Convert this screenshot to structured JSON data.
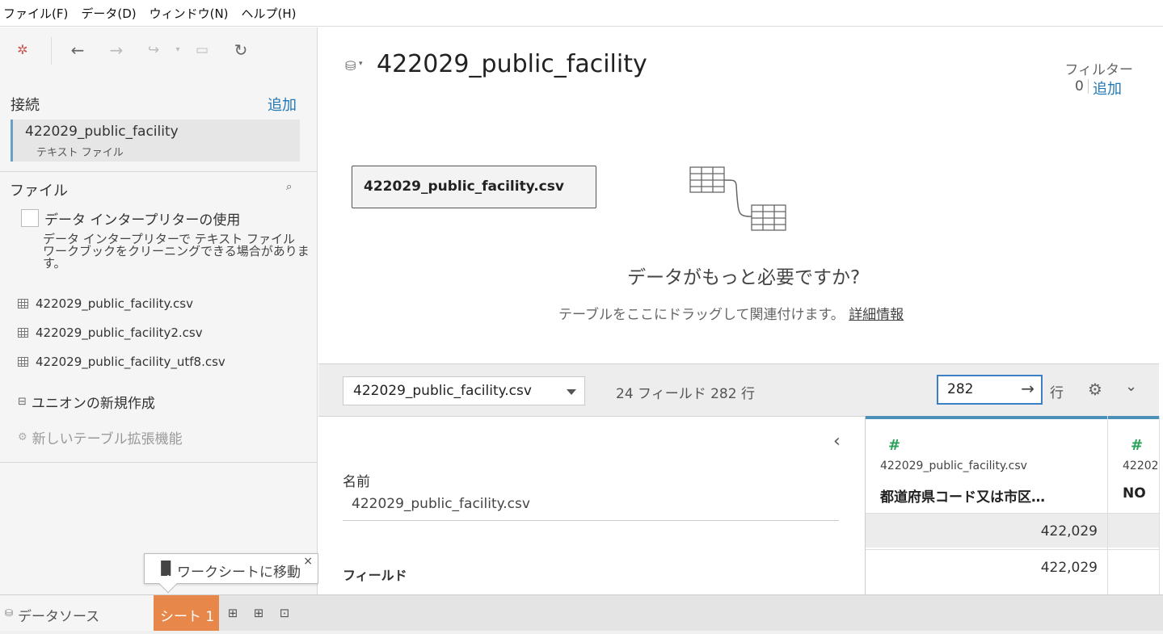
{
  "menubar": {
    "items": [
      "ファイル(F)",
      "データ(D)",
      "ウィンドウ(N)",
      "ヘルプ(H)"
    ]
  },
  "toolbar": {
    "icons": [
      "tableau-logo-icon",
      "back-icon",
      "forward-icon",
      "redo-icon",
      "save-icon",
      "refresh-icon"
    ]
  },
  "connections": {
    "title": "接続",
    "add_label": "追加",
    "item": {
      "name": "422029_public_facility",
      "type": "テキスト ファイル"
    }
  },
  "files": {
    "title": "ファイル",
    "interpreter_label": "データ インタープリターの使用",
    "interpreter_desc_line1": "データ インタープリターで テキスト ファイル",
    "interpreter_desc_line2": "ワークブックをクリーニングできる場合がありま",
    "interpreter_desc_line3": "す。",
    "list": [
      "422029_public_facility.csv",
      "422029_public_facility2.csv",
      "422029_public_facility_utf8.csv"
    ],
    "union_label": "ユニオンの新規作成",
    "extension_label": "新しいテーブル拡張機能"
  },
  "tooltip": {
    "text": "ワークシートに移動",
    "close": "×"
  },
  "main": {
    "title": "422029_public_facility",
    "filter_label": "フィルター",
    "filter_count": "0",
    "filter_add": "追加",
    "table_chip": "422029_public_facility.csv",
    "more_data_title": "データがもっと必要ですか?",
    "more_data_sub": "テーブルをここにドラッグして関連付けます。",
    "more_data_link": "詳細情報"
  },
  "gridbar": {
    "selected_table": "422029_public_facility.csv",
    "field_count": "24 フィールド 282 行",
    "rows_value": "282",
    "rows_label": "行"
  },
  "meta": {
    "name_label": "名前",
    "name_value": "422029_public_facility.csv",
    "fields_label": "フィールド"
  },
  "grid": {
    "columns": [
      {
        "source": "422029_public_facility.csv",
        "name": "都道府県コード又は市区…",
        "cells": [
          "422,029",
          "422,029"
        ]
      },
      {
        "source": "42202",
        "name": "NO",
        "cells": [
          "",
          ""
        ]
      }
    ]
  },
  "tabs": {
    "datasource": "データソース",
    "sheet": "シート 1"
  },
  "colors": {
    "accent": "#1f77b4",
    "sheet_tab": "#e8874a",
    "number_icon": "#2aa15a"
  }
}
